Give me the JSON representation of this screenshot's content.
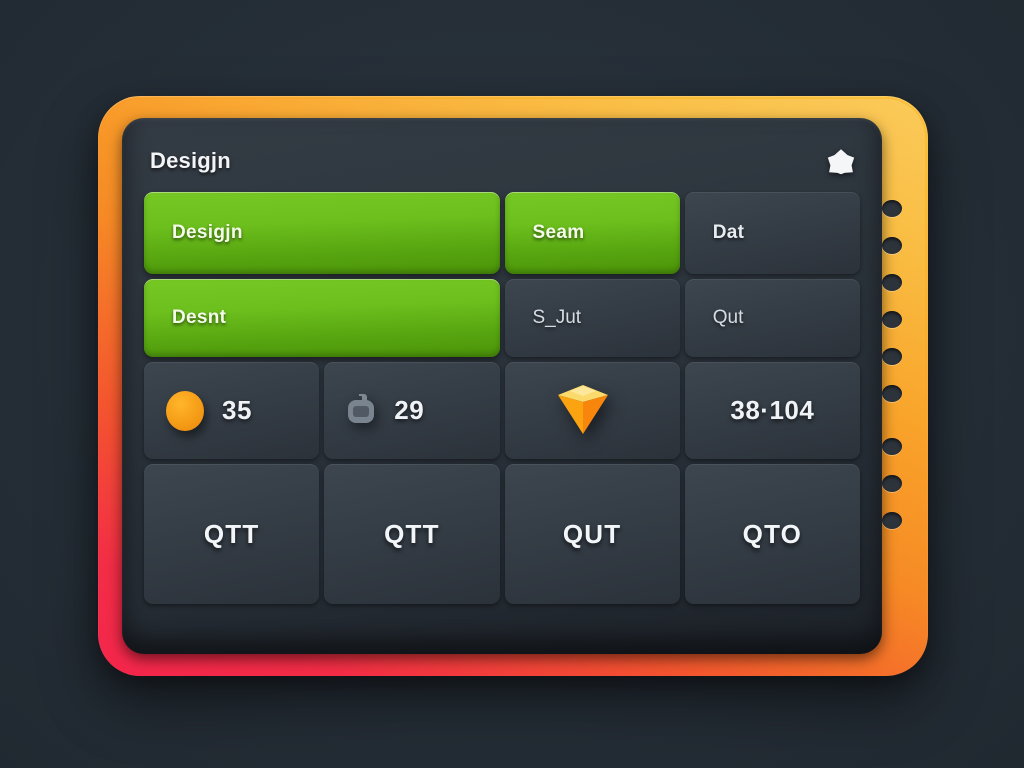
{
  "header": {
    "title": "Desigjn",
    "badge_icon": "star-icon"
  },
  "theme": {
    "frame_gradient_start": "#fac03a",
    "frame_gradient_end": "#f4264c",
    "screen_bg": "#2d353d",
    "accent_green": "#6cbf1d",
    "accent_orange": "#f59b16",
    "page_bg": "#262f38",
    "text_primary": "#f2f4f6"
  },
  "grid": {
    "row1": [
      {
        "label": "Desigjn",
        "style": "green",
        "span": 2,
        "name": "tile-design"
      },
      {
        "label": "Seam",
        "style": "green",
        "span": 1,
        "name": "tile-seam"
      },
      {
        "label": "Dat",
        "style": "dark",
        "span": 1,
        "name": "tile-dat"
      }
    ],
    "row2": [
      {
        "label": "Desnt",
        "style": "green",
        "span": 2,
        "name": "tile-desnt"
      },
      {
        "label": "S_Jut",
        "style": "dark",
        "span": 1,
        "name": "tile-sjut"
      },
      {
        "label": "Qut",
        "style": "dark",
        "span": 1,
        "name": "tile-qut"
      }
    ],
    "row3": [
      {
        "icon": "orange-circle-icon",
        "value": "35",
        "name": "stat-tile-35"
      },
      {
        "icon": "lock-icon",
        "value": "29",
        "name": "stat-tile-29"
      },
      {
        "icon": "gem-icon",
        "value": "",
        "name": "stat-tile-gem"
      },
      {
        "icon": "",
        "value": "38·104",
        "name": "stat-tile-38104"
      }
    ],
    "row4": [
      {
        "label": "QTT",
        "name": "code-tile-qtt-1"
      },
      {
        "label": "QTT",
        "name": "code-tile-qtt-2"
      },
      {
        "label": "QUT",
        "name": "code-tile-qut"
      },
      {
        "label": "QTO",
        "name": "code-tile-qto"
      }
    ]
  },
  "perforation": {
    "dot_count": 9,
    "dot_color": "#2c333b"
  }
}
